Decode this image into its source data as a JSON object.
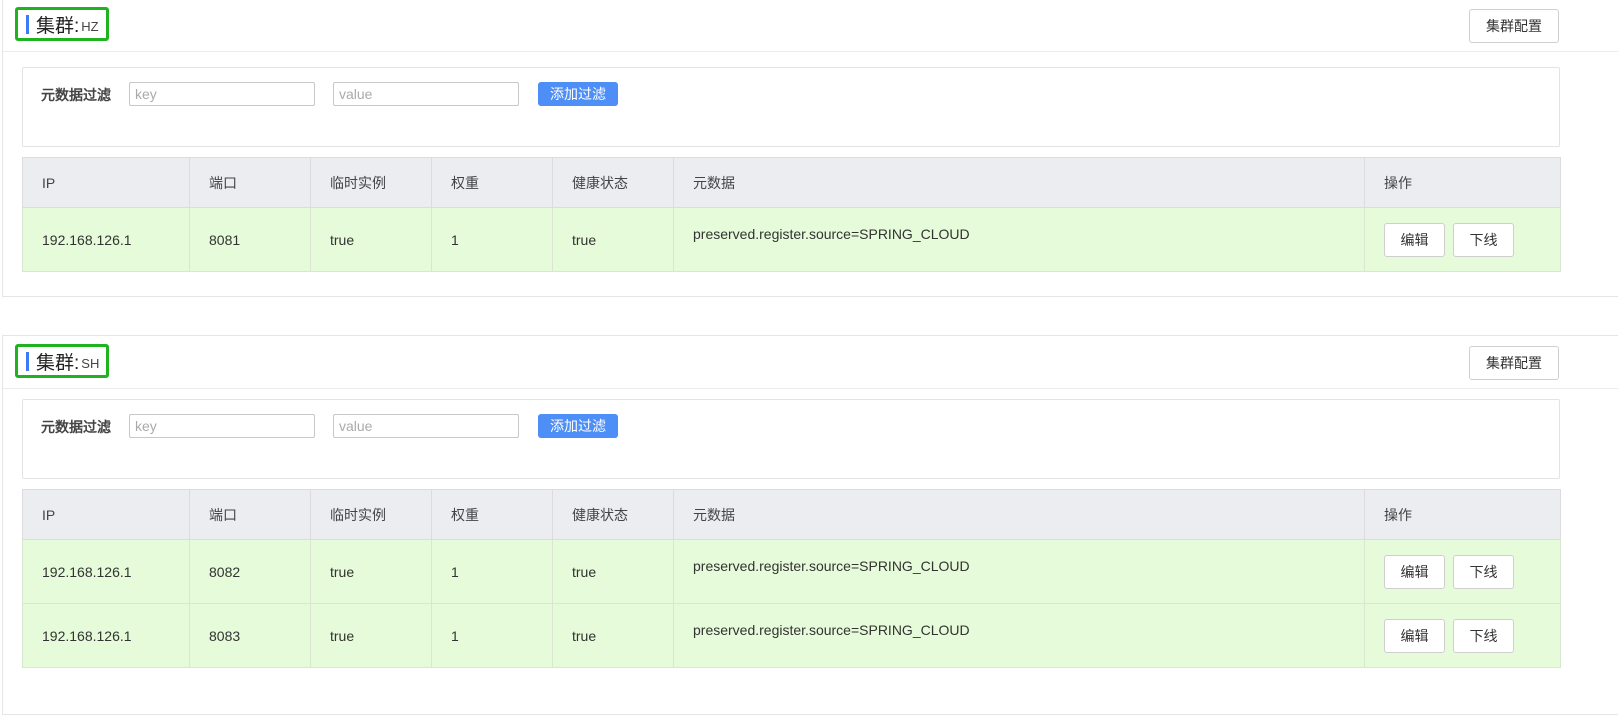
{
  "clusters": [
    {
      "title_label": "集群:",
      "name": "HZ",
      "config_button": "集群配置",
      "filter": {
        "label": "元数据过滤",
        "key_placeholder": "key",
        "value_placeholder": "value",
        "add_button": "添加过滤"
      },
      "columns": [
        "IP",
        "端口",
        "临时实例",
        "权重",
        "健康状态",
        "元数据",
        "操作"
      ],
      "rows": [
        {
          "ip": "192.168.126.1",
          "port": "8081",
          "ephemeral": "true",
          "weight": "1",
          "healthy": "true",
          "metadata": "preserved.register.source=SPRING_CLOUD",
          "edit": "编辑",
          "offline": "下线"
        }
      ]
    },
    {
      "title_label": "集群:",
      "name": "SH",
      "config_button": "集群配置",
      "filter": {
        "label": "元数据过滤",
        "key_placeholder": "key",
        "value_placeholder": "value",
        "add_button": "添加过滤"
      },
      "columns": [
        "IP",
        "端口",
        "临时实例",
        "权重",
        "健康状态",
        "元数据",
        "操作"
      ],
      "rows": [
        {
          "ip": "192.168.126.1",
          "port": "8082",
          "ephemeral": "true",
          "weight": "1",
          "healthy": "true",
          "metadata": "preserved.register.source=SPRING_CLOUD",
          "edit": "编辑",
          "offline": "下线"
        },
        {
          "ip": "192.168.126.1",
          "port": "8083",
          "ephemeral": "true",
          "weight": "1",
          "healthy": "true",
          "metadata": "preserved.register.source=SPRING_CLOUD",
          "edit": "编辑",
          "offline": "下线"
        }
      ]
    }
  ],
  "colors": {
    "title_highlight": "#1fb31f",
    "title_accent_bar": "#3d7af5",
    "primary_button": "#4d8ef7",
    "header_background": "#ebedf0",
    "row_background": "#e5fbd9"
  }
}
